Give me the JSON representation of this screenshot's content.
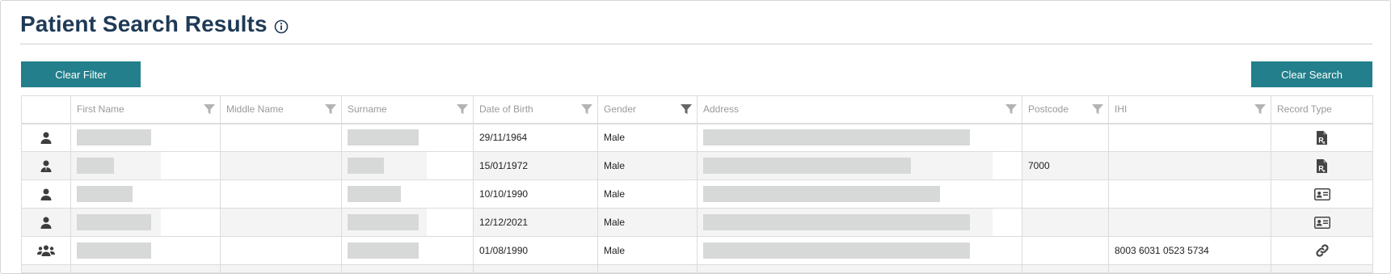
{
  "page": {
    "title": "Patient Search Results"
  },
  "buttons": {
    "clear_filter": "Clear Filter",
    "clear_search": "Clear Search"
  },
  "table": {
    "columns": [
      "",
      "First Name",
      "Middle Name",
      "Surname",
      "Date of Birth",
      "Gender",
      "Address",
      "Postcode",
      "IHI",
      "Record Type"
    ],
    "rows": [
      {
        "person_icon": "person-icon",
        "first_name": "",
        "middle_name": "",
        "surname": "",
        "dob": "29/11/1964",
        "gender": "Male",
        "address": "",
        "postcode": "",
        "ihi": "",
        "record_type_icon": "prescription-icon"
      },
      {
        "person_icon": "person-tie-icon",
        "first_name": "",
        "middle_name": "",
        "surname": "",
        "dob": "15/01/1972",
        "gender": "Male",
        "address": "",
        "postcode": "7000",
        "ihi": "",
        "record_type_icon": "prescription-icon"
      },
      {
        "person_icon": "person-icon",
        "first_name": "",
        "middle_name": "",
        "surname": "",
        "dob": "10/10/1990",
        "gender": "Male",
        "address": "",
        "postcode": "",
        "ihi": "",
        "record_type_icon": "id-card-icon"
      },
      {
        "person_icon": "person-icon",
        "first_name": "",
        "middle_name": "",
        "surname": "",
        "dob": "12/12/2021",
        "gender": "Male",
        "address": "",
        "postcode": "",
        "ihi": "",
        "record_type_icon": "id-card-icon"
      },
      {
        "person_icon": "group-icon",
        "first_name": "",
        "middle_name": "",
        "surname": "",
        "dob": "01/08/1990",
        "gender": "Male",
        "address": "",
        "postcode": "",
        "ihi": "8003 6031 0523 5734",
        "record_type_icon": "link-icon"
      }
    ]
  },
  "colors": {
    "title": "#1f3a56",
    "button": "#227f8b",
    "redaction": "#d7d8d8",
    "row_alt": "#f4f4f4"
  }
}
